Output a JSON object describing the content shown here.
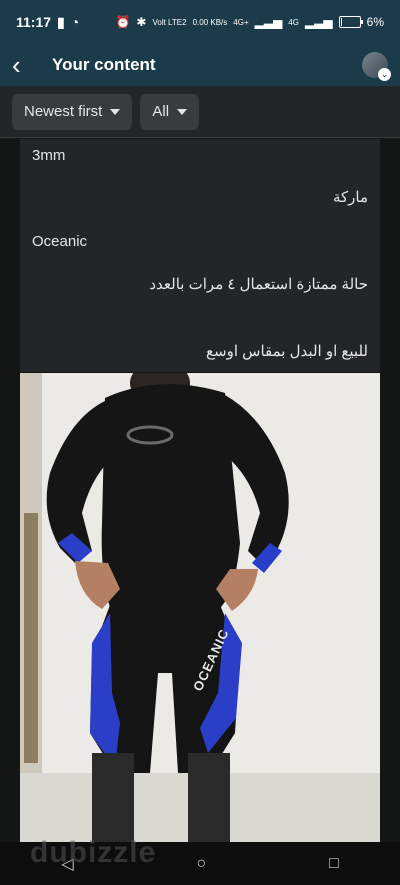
{
  "status": {
    "time": "11:17",
    "network": "Volt LTE2",
    "speed": "0.00 KB/s",
    "net1": "4G+",
    "net2": "4G",
    "battery": "6%",
    "battery_level": 0.06
  },
  "header": {
    "title": "Your content"
  },
  "filters": {
    "sort_label": "Newest first",
    "type_label": "All"
  },
  "post": {
    "lines": [
      "3mm",
      "ماركة",
      "Oceanic",
      "حالة ممتازة استعمال ٤ مرات بالعدد",
      "للبيع او البدل بمقاس اوسع"
    ]
  },
  "photo": {
    "suit_brand_text": "OCEANIC",
    "watermark": "dubizzle"
  },
  "colors": {
    "header_bg": "#1b3a4a",
    "page_bg": "#18191a",
    "chip_bg": "#3a3b3c",
    "suit_black": "#141414",
    "suit_blue": "#2b3ec8"
  },
  "icons": {
    "back": "arrow-left-icon",
    "nav": [
      "back-triangle-icon",
      "home-circle-icon",
      "recents-square-icon"
    ]
  }
}
